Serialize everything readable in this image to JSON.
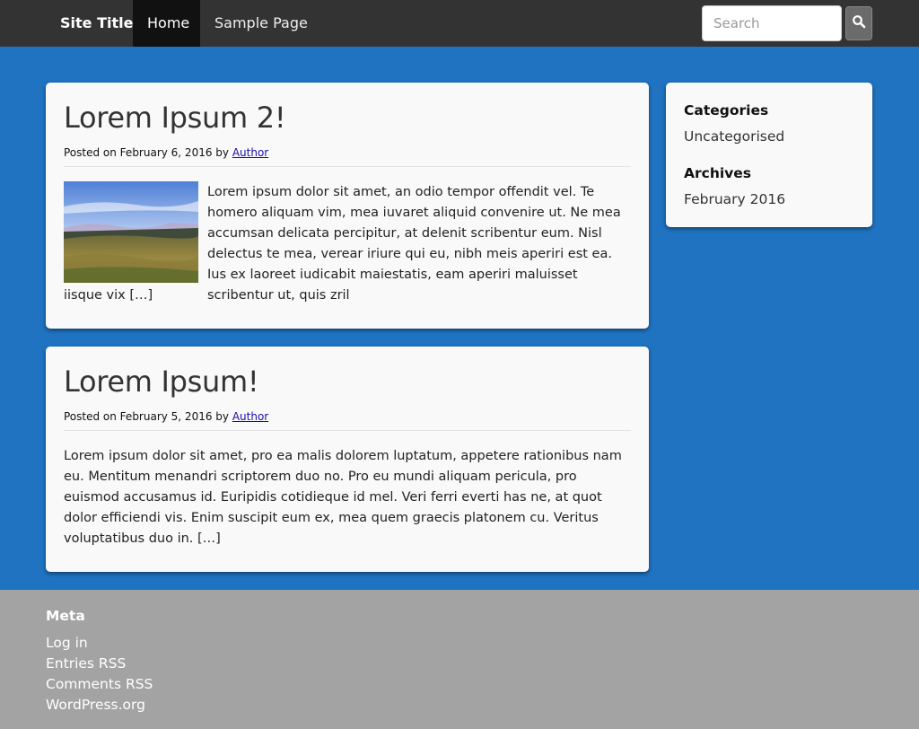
{
  "navbar": {
    "site_title": "Site Title",
    "links": [
      {
        "label": "Home"
      },
      {
        "label": "Sample Page"
      }
    ],
    "search_placeholder": "Search",
    "search_icon": "search-icon"
  },
  "posts": [
    {
      "title": "Lorem Ipsum 2!",
      "meta_prefix": "Posted on February 6, 2016 by",
      "author": "Author",
      "excerpt_a": "Lorem ipsum dolor sit amet, an odio tempor offendit vel. Te homero aliquam vim, mea iuvaret aliquid convenire ut. Ne mea accumsan delicata percipitur, at delenit scribentur eum. Nisl delectus te mea, verear iriure qui eu, nibh meis aperiri est ea. Ius ex laoreet iudicabit maiestatis, eam aperiri maluisset scribentur ut, quis zril",
      "excerpt_b": "iisque vix […]"
    },
    {
      "title": "Lorem Ipsum!",
      "meta_prefix": "Posted on February 5, 2016 by",
      "author": "Author",
      "excerpt": "Lorem ipsum dolor sit amet, pro ea malis dolorem luptatum, appetere rationibus nam eu. Mentitum menandri scriptorem duo no. Pro eu mundi aliquam pericula, pro euismod accusamus id. Euripidis cotidieque id mel. Veri ferri everti has ne, at quot dolor efficiendi vis. Enim suscipit eum ex, mea quem graecis platonem cu. Veritus voluptatibus duo in. […]"
    }
  ],
  "sidebar": {
    "categories_title": "Categories",
    "categories": [
      "Uncategorised"
    ],
    "archives_title": "Archives",
    "archives": [
      "February 2016"
    ]
  },
  "footer": {
    "meta_title": "Meta",
    "links": [
      "Log in",
      "Entries RSS",
      "Comments RSS",
      "WordPress.org"
    ]
  },
  "colors": {
    "page_background": "#1f73c1",
    "navbar": "#333333",
    "footer": "#a3a3a3"
  }
}
